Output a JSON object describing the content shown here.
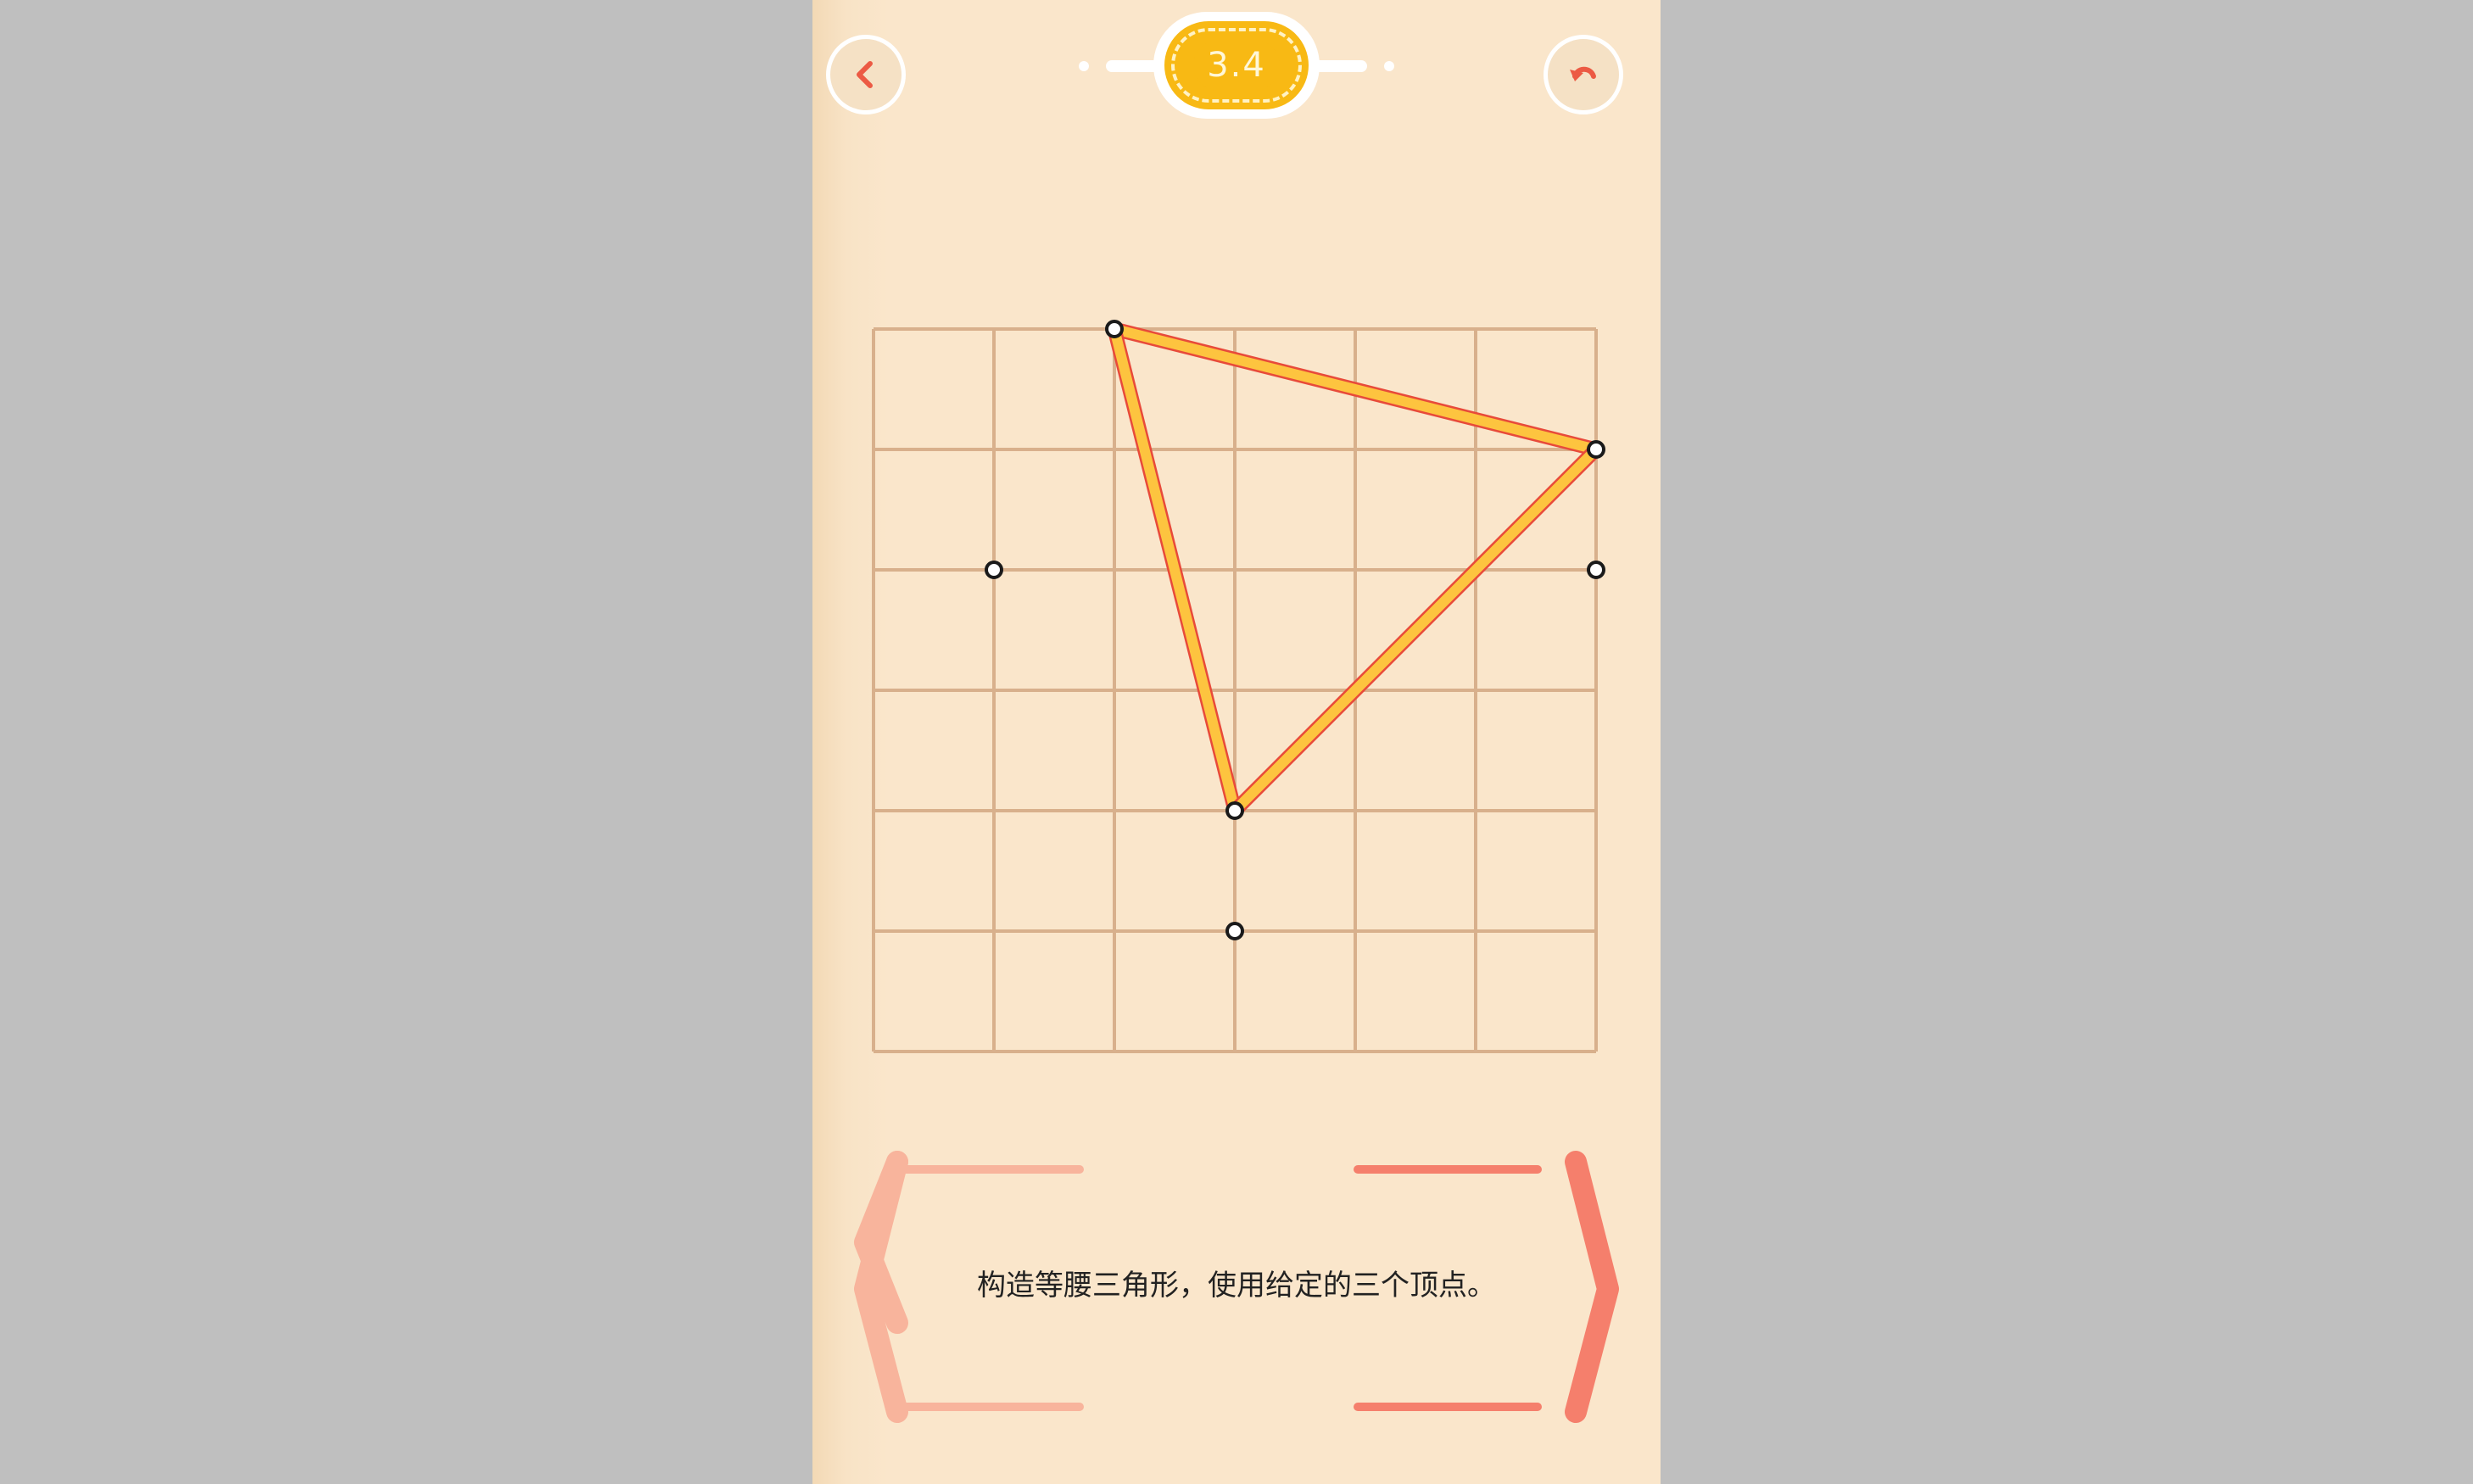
{
  "header": {
    "level": "3.4",
    "back_icon": "chevron-left-icon",
    "undo_icon": "undo-arrow-icon"
  },
  "colors": {
    "accent_red": "#ec5a44",
    "level_gold": "#f8b914",
    "grid_line": "#d8b08c",
    "stick_yellow": "#fdc43f",
    "stick_edge": "#e84a3a",
    "nav_prev": "#f8b49c",
    "nav_next": "#f57f6c"
  },
  "grid": {
    "cols": 6,
    "rows": 6
  },
  "points": [
    {
      "gx": 2,
      "gy": 0
    },
    {
      "gx": 6,
      "gy": 1
    },
    {
      "gx": 1,
      "gy": 2
    },
    {
      "gx": 6,
      "gy": 2
    },
    {
      "gx": 3,
      "gy": 4
    },
    {
      "gx": 3,
      "gy": 5
    }
  ],
  "segments": [
    {
      "from": [
        2,
        0
      ],
      "to": [
        6,
        1
      ]
    },
    {
      "from": [
        2,
        0
      ],
      "to": [
        3,
        4
      ]
    },
    {
      "from": [
        6,
        1
      ],
      "to": [
        3,
        4
      ]
    }
  ],
  "prompt": {
    "text": "构造等腰三角形，使用给定的三个顶点。"
  }
}
